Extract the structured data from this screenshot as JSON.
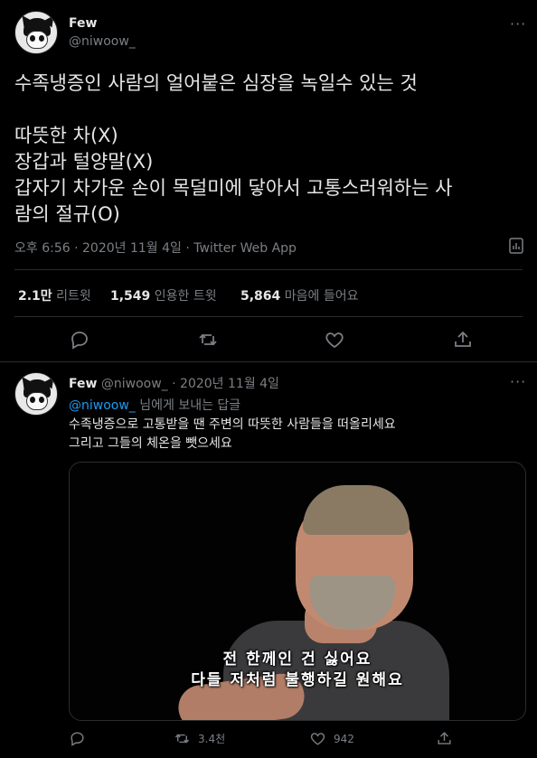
{
  "tweet": {
    "author_name": "Few",
    "author_handle": "@niwoow_",
    "text": "수족냉증인 사람의 얼어붙은 심장을 녹일수 있는 것\n\n따뜻한 차(X)\n장갑과 털양말(X)\n갑자기 차가운 손이 목덜미에 닿아서 고통스러워하는 사\n람의 절규(O)",
    "meta": "오후 6:56 · 2020년 11월 4일 · Twitter Web App",
    "stats": {
      "retweets_value": "2.1만",
      "retweets_label": "리트윗",
      "quotes_value": "1,549",
      "quotes_label": "인용한 트윗",
      "likes_value": "5,864",
      "likes_label": "마음에 들어요"
    }
  },
  "reply": {
    "author_name": "Few",
    "author_handle": "@niwoow_",
    "date": "· 2020년 11월 4일",
    "reply_to_mention": "@niwoow_",
    "reply_to_suffix": " 님에게 보내는 답글",
    "text": "수족냉증으로 고통받을 땐 주변의 따뜻한 사람들을 떠올리세요\n그리고 그들의 체온을 뺏으세요",
    "subtitle_line1": "전 한께인 건 싫어요",
    "subtitle_line2": "다들 저처럼 불행하길 원해요",
    "retweet_count": "3.4천",
    "like_count": "942"
  },
  "icons": {
    "more": "more-icon",
    "analytics": "analytics-icon",
    "reply": "reply-icon",
    "retweet": "retweet-icon",
    "like": "like-icon",
    "share": "share-icon"
  },
  "colors": {
    "background": "#000000",
    "text": "#e6e6e6",
    "muted": "#7b7f84",
    "link": "#1d9bf0"
  }
}
